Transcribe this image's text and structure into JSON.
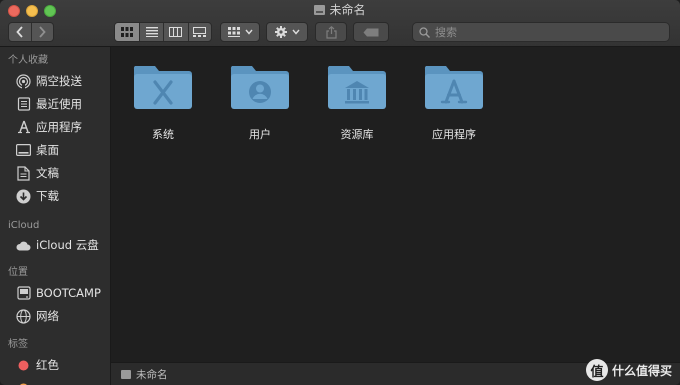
{
  "window": {
    "title": "未命名"
  },
  "toolbar": {
    "back_icon": "chevron-left-icon",
    "forward_icon": "chevron-right-icon",
    "view_modes": [
      "icon-view",
      "list-view",
      "column-view",
      "gallery-view"
    ],
    "selected_view": "icon-view",
    "group_icon": "grid-icon",
    "action_icon": "gear-icon",
    "share_icon": "share-icon",
    "tag_icon": "tag-icon"
  },
  "search": {
    "placeholder": "搜索"
  },
  "sidebar": {
    "sections": [
      {
        "header": "个人收藏"
      },
      {
        "header": "iCloud"
      },
      {
        "header": "位置"
      },
      {
        "header": "标签"
      }
    ],
    "favorites": [
      {
        "label": "隔空投送",
        "icon": "airdrop-icon"
      },
      {
        "label": "最近使用",
        "icon": "recents-icon"
      },
      {
        "label": "应用程序",
        "icon": "applications-icon"
      },
      {
        "label": "桌面",
        "icon": "desktop-icon"
      },
      {
        "label": "文稿",
        "icon": "documents-icon"
      },
      {
        "label": "下载",
        "icon": "downloads-icon"
      }
    ],
    "icloud": [
      {
        "label": "iCloud 云盘",
        "icon": "cloud-icon"
      }
    ],
    "locations": [
      {
        "label": "BOOTCAMP",
        "icon": "disk-icon"
      },
      {
        "label": "网络",
        "icon": "network-icon"
      }
    ],
    "tags": [
      {
        "label": "红色",
        "color": "#ec5f5f"
      }
    ]
  },
  "main": {
    "folders": [
      {
        "name": "系统",
        "icon": "system-folder-icon"
      },
      {
        "name": "用户",
        "icon": "users-folder-icon"
      },
      {
        "name": "资源库",
        "icon": "library-folder-icon"
      },
      {
        "name": "应用程序",
        "icon": "applications-folder-icon"
      }
    ]
  },
  "statusbar": {
    "path": "未命名"
  },
  "watermark": {
    "badge": "值",
    "text": "什么值得买"
  },
  "colors": {
    "folder": "#6fa7d0",
    "folder_dark": "#5b94bf",
    "folder_symbol": "#4f86b1",
    "tag_red": "#ec5f5f"
  }
}
